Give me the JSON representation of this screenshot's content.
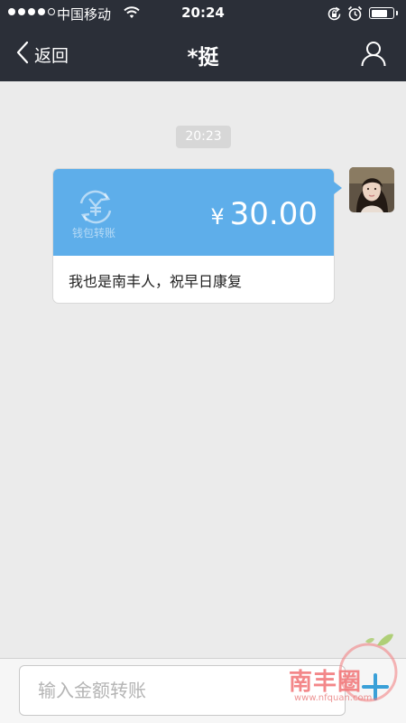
{
  "status_bar": {
    "carrier": "中国移动",
    "time": "20:24",
    "signal_bars_filled": 4,
    "signal_bars_total": 5,
    "battery_level": 0.8,
    "icons": [
      "signal-icon",
      "wifi-icon",
      "orientation-lock-icon",
      "alarm-icon",
      "battery-icon"
    ]
  },
  "nav": {
    "back_label": "返回",
    "title": "*挺",
    "back_icon": "chevron-left-icon",
    "profile_icon": "person-icon"
  },
  "chat": {
    "timestamp": "20:23",
    "transfer": {
      "badge_label": "钱包转账",
      "badge_icon": "yen-coin-icon",
      "currency": "¥",
      "amount": "30.00",
      "memo": "我也是南丰人，祝早日康复"
    },
    "avatar_icon": "user-photo-avatar"
  },
  "input": {
    "placeholder": "输入金额转账",
    "value": "",
    "plus_icon": "plus-icon"
  },
  "watermark": {
    "text": "南丰圈",
    "url": "www.nfquan.com"
  },
  "colors": {
    "nav_bg": "#2b2f38",
    "chat_bg": "#ebebeb",
    "transfer_blue": "#5eaeea",
    "plus_blue": "#3aa0d8",
    "watermark_red": "#f27a7c"
  }
}
